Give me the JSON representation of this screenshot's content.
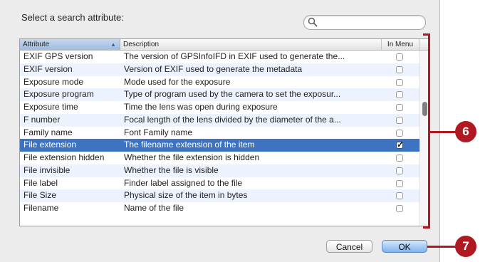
{
  "prompt": "Select a search attribute:",
  "search": {
    "placeholder": "",
    "icon": "search-icon"
  },
  "table": {
    "headers": {
      "attribute": "Attribute",
      "description": "Description",
      "in_menu": "In Menu"
    },
    "rows": [
      {
        "attribute": "EXIF GPS version",
        "description": "The version of GPSInfoIFD in EXIF used to generate the...",
        "in_menu": false
      },
      {
        "attribute": "EXIF version",
        "description": "Version of EXIF used to generate the metadata",
        "in_menu": false
      },
      {
        "attribute": "Exposure mode",
        "description": "Mode used for the exposure",
        "in_menu": false
      },
      {
        "attribute": "Exposure program",
        "description": "Type of program used by the camera to set the exposur...",
        "in_menu": false
      },
      {
        "attribute": "Exposure time",
        "description": "Time the lens was open during exposure",
        "in_menu": false
      },
      {
        "attribute": "F number",
        "description": "Focal length of the lens divided by the diameter of the a...",
        "in_menu": false
      },
      {
        "attribute": "Family name",
        "description": "Font Family name",
        "in_menu": false
      },
      {
        "attribute": "File extension",
        "description": "The filename extension of the item",
        "in_menu": true,
        "selected": true
      },
      {
        "attribute": "File extension hidden",
        "description": "Whether the file extension is hidden",
        "in_menu": false
      },
      {
        "attribute": "File invisible",
        "description": "Whether the file is visible",
        "in_menu": false
      },
      {
        "attribute": "File label",
        "description": "Finder label assigned to the file",
        "in_menu": false
      },
      {
        "attribute": "File Size",
        "description": "Physical size of the item in bytes",
        "in_menu": false
      },
      {
        "attribute": "Filename",
        "description": "Name of the file",
        "in_menu": false
      }
    ]
  },
  "buttons": {
    "cancel": "Cancel",
    "ok": "OK"
  },
  "callouts": {
    "table": "6",
    "ok": "7"
  },
  "colors": {
    "callout": "#b01921",
    "selection": "#3d73c1"
  }
}
